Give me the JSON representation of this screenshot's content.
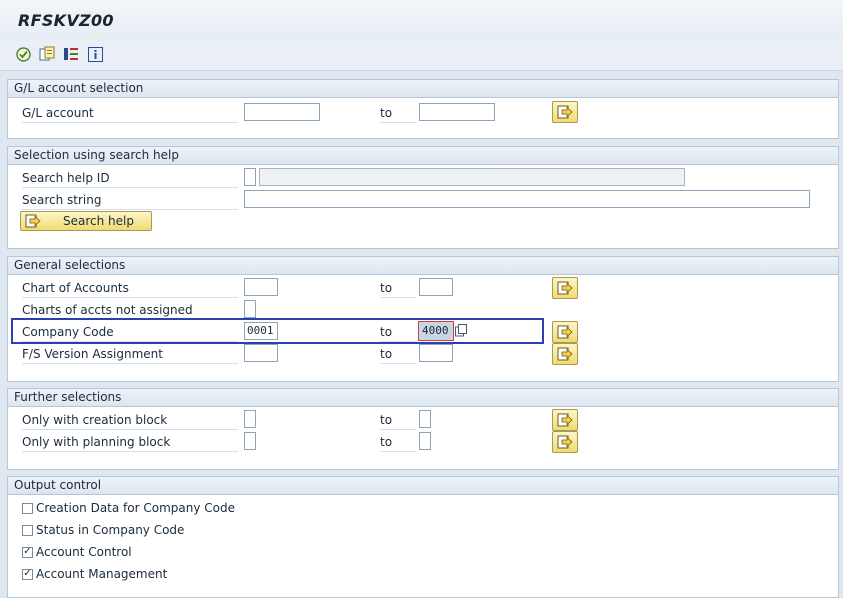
{
  "window": {
    "title": "RFSKVZ00"
  },
  "toolbar": {
    "buttons": [
      {
        "icon": "execute-icon"
      },
      {
        "icon": "get-variant-icon"
      },
      {
        "icon": "selection-options-icon"
      },
      {
        "icon": "info-icon"
      }
    ]
  },
  "gl_account_selection": {
    "header": "G/L account selection",
    "gl_account": {
      "label": "G/L account",
      "from": "",
      "to_label": "to",
      "to": ""
    }
  },
  "search_help": {
    "header": "Selection using search help",
    "search_help_id": {
      "label": "Search help ID",
      "value": "",
      "description": ""
    },
    "search_string": {
      "label": "Search string",
      "value": ""
    },
    "button_label": "Search help"
  },
  "general_selections": {
    "header": "General selections",
    "chart_of_accounts": {
      "label": "Chart of Accounts",
      "from": "",
      "to_label": "to",
      "to": ""
    },
    "charts_not_assigned": {
      "label": "Charts of accts not assigned",
      "value": ""
    },
    "company_code": {
      "label": "Company Code",
      "from": "0001",
      "to_label": "to",
      "to": "4000"
    },
    "fs_version": {
      "label": "F/S Version Assignment",
      "from": "",
      "to_label": "to",
      "to": ""
    }
  },
  "further_selections": {
    "header": "Further selections",
    "creation_block": {
      "label": "Only with creation block",
      "from": "",
      "to_label": "to",
      "to": ""
    },
    "planning_block": {
      "label": "Only with planning block",
      "from": "",
      "to_label": "to",
      "to": ""
    }
  },
  "output_control": {
    "header": "Output control",
    "options": [
      {
        "label": "Creation Data for Company Code",
        "checked": false
      },
      {
        "label": "Status in Company Code",
        "checked": false
      },
      {
        "label": "Account Control",
        "checked": true
      },
      {
        "label": "Account Management",
        "checked": true
      }
    ]
  },
  "colors": {
    "accent": "#2b3fb0",
    "button_yellow": "#f0dc70",
    "panel_header": "#dce6f0"
  }
}
